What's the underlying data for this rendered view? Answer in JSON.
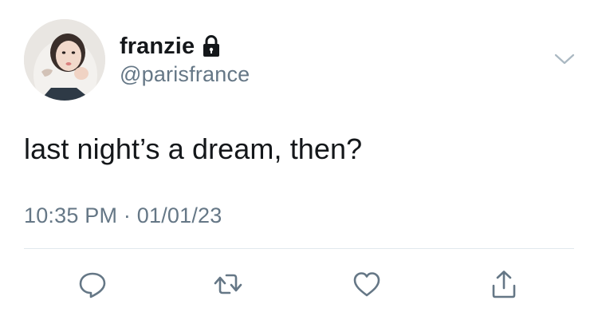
{
  "tweet": {
    "author": {
      "display_name": "franzie",
      "handle": "@parisfrance",
      "avatar_icon": "profile-photo",
      "protected_icon": "lock-icon"
    },
    "text": "last night’s a dream, then?",
    "timestamp": "10:35 PM · 01/01/23",
    "menu_icon": "chevron-down-icon"
  },
  "actions": [
    {
      "name": "reply",
      "icon": "reply-icon"
    },
    {
      "name": "retweet",
      "icon": "retweet-icon"
    },
    {
      "name": "like",
      "icon": "heart-icon"
    },
    {
      "name": "share",
      "icon": "share-icon"
    }
  ],
  "colors": {
    "text_primary": "#14171a",
    "text_secondary": "#657786",
    "divider": "#e1e8ed",
    "icon": "#657786"
  }
}
